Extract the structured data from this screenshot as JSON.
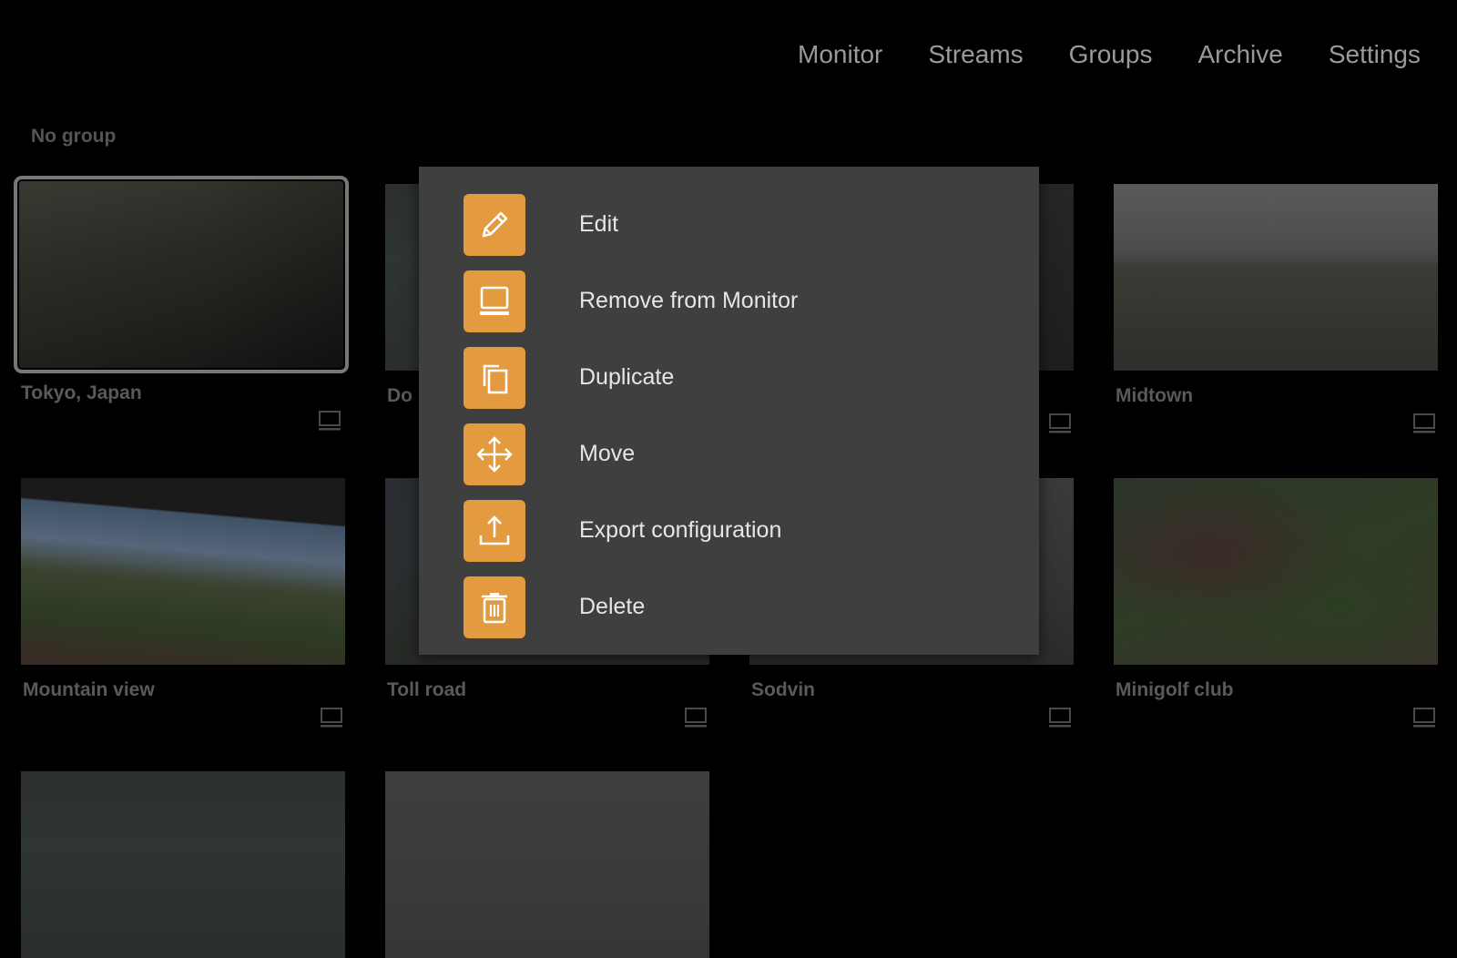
{
  "nav": {
    "items": [
      "Monitor",
      "Streams",
      "Groups",
      "Archive",
      "Settings"
    ]
  },
  "group": {
    "label": "No group"
  },
  "tiles": [
    {
      "name": "Tokyo, Japan"
    },
    {
      "name": "Do"
    },
    {
      "name": ""
    },
    {
      "name": "Midtown"
    },
    {
      "name": "Mountain view"
    },
    {
      "name": "Toll road"
    },
    {
      "name": "Sodvin"
    },
    {
      "name": "Minigolf club"
    }
  ],
  "menu": {
    "items": [
      {
        "label": "Edit",
        "icon": "pencil-icon"
      },
      {
        "label": "Remove from Monitor",
        "icon": "monitor-icon"
      },
      {
        "label": "Duplicate",
        "icon": "copy-icon"
      },
      {
        "label": "Move",
        "icon": "move-arrows-icon"
      },
      {
        "label": "Export configuration",
        "icon": "upload-icon"
      },
      {
        "label": "Delete",
        "icon": "trash-icon"
      }
    ]
  },
  "colors": {
    "accent": "#e49a3f",
    "menu_bg": "#3f3f3f",
    "background": "#000000"
  }
}
